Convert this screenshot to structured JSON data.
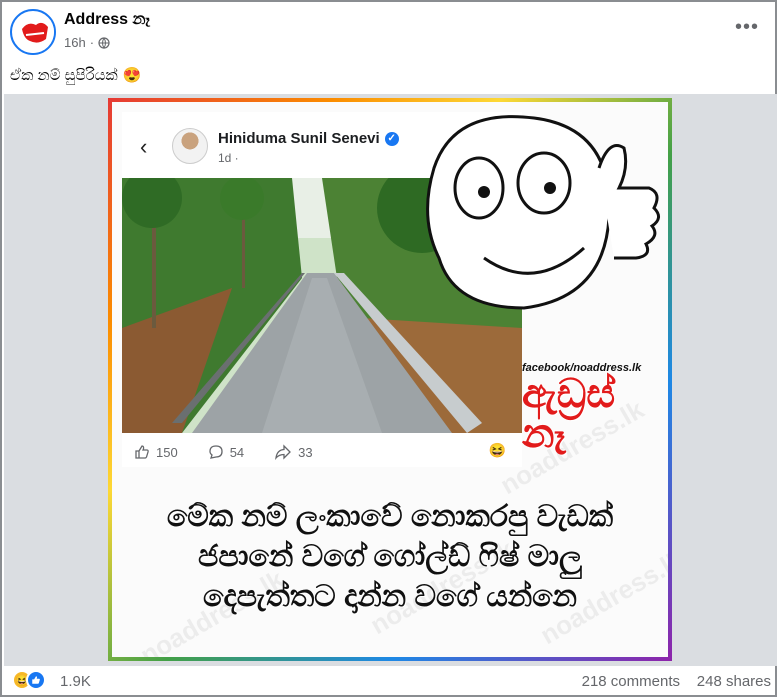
{
  "post": {
    "author": "Address නෑ",
    "time": "16h",
    "separator": "·",
    "caption": "ඒක නම් සුපිරියක්",
    "caption_emoji": "😍"
  },
  "embedded_post": {
    "author": "Hiniduma Sunil Senevi",
    "verified_mark": "✓",
    "time": "1d ·",
    "likes": "150",
    "comments": "54",
    "shares": "33"
  },
  "meme": {
    "brand_url": "facebook/noaddress.lk",
    "brand_logo": "ඇඩ්‍රස් නෑ",
    "headline_lines": [
      "මේක නම් ලංකාවේ නොකරපු වැඩක්",
      "ජපානේ වගේ ගෝල්ඩ් ෆිෂ් මාලු",
      "දෙපැත්තට දාන්න වගේ යන්නෙ"
    ],
    "watermark": "noaddress.lk"
  },
  "footer": {
    "reaction_count": "1.9K",
    "comments": "218 comments",
    "shares": "248 shares"
  },
  "colors": {
    "facebook_blue": "#1877f2",
    "brand_red": "#e21b1b",
    "meta_gray": "#65676b"
  },
  "icons": [
    "globe-icon",
    "more-options-icon",
    "back-arrow-icon",
    "like-icon",
    "comment-icon",
    "share-icon",
    "haha-reaction-icon",
    "like-reaction-icon"
  ]
}
